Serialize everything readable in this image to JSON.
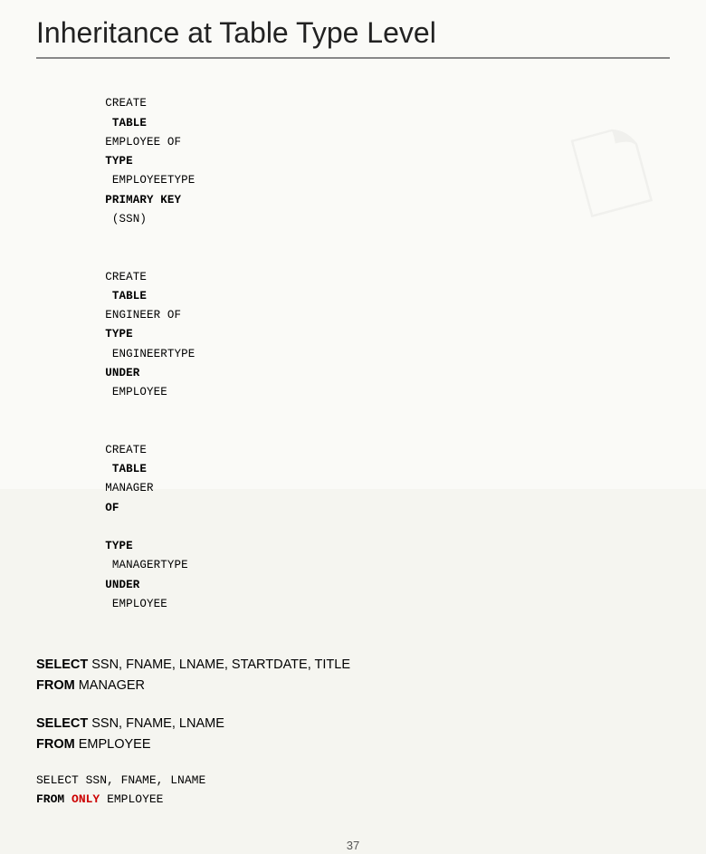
{
  "slide": {
    "title": "Inheritance at Table Type Level",
    "top_border_color": "#c8b84a",
    "bottom_border_color": "#c8b84a",
    "page_number": "37",
    "create_block": {
      "lines": [
        {
          "parts": [
            {
              "text": "CREATE",
              "style": "normal"
            },
            {
              "text": " TABLE ",
              "style": "bold"
            },
            {
              "text": "EMPLOYEE OF ",
              "style": "normal"
            },
            {
              "text": "TYPE",
              "style": "bold"
            },
            {
              "text": " EMPLOYEETYPE ",
              "style": "normal"
            },
            {
              "text": "PRIMARY KEY",
              "style": "bold"
            },
            {
              "text": " (SSN)",
              "style": "normal"
            }
          ]
        },
        {
          "parts": [
            {
              "text": "CREATE",
              "style": "normal"
            },
            {
              "text": " TABLE ",
              "style": "bold"
            },
            {
              "text": "ENGINEER OF ",
              "style": "normal"
            },
            {
              "text": "TYPE",
              "style": "bold"
            },
            {
              "text": " ENGINEERTYPE ",
              "style": "normal"
            },
            {
              "text": "UNDER",
              "style": "bold"
            },
            {
              "text": " EMPLOYEE",
              "style": "normal"
            }
          ]
        },
        {
          "parts": [
            {
              "text": "CREATE",
              "style": "normal"
            },
            {
              "text": " TABLE ",
              "style": "bold"
            },
            {
              "text": "MANAGER ",
              "style": "normal"
            },
            {
              "text": "OF",
              "style": "bold"
            },
            {
              "text": " ",
              "style": "normal"
            },
            {
              "text": "TYPE",
              "style": "bold"
            },
            {
              "text": " MANAGERTYPE ",
              "style": "normal"
            },
            {
              "text": "UNDER",
              "style": "bold"
            },
            {
              "text": " EMPLOYEE",
              "style": "normal"
            }
          ]
        }
      ]
    },
    "select_blocks": [
      {
        "id": "select1",
        "line1_bold": "SELECT",
        "line1_normal": " SSN, FNAME, LNAME, STARTDATE, TITLE",
        "line2_bold": "FROM",
        "line2_normal": " MANAGER"
      },
      {
        "id": "select2",
        "line1_bold": "SELECT",
        "line1_normal": " SSN, FNAME, LNAME",
        "line2_bold": "FROM",
        "line2_normal": " EMPLOYEE"
      },
      {
        "id": "select3",
        "line1_keyword": "SELECT",
        "line1_normal": " SSN,  FNAME,  LNAME",
        "line2_from": "FROM",
        "line2_only": " ONLY",
        "line2_normal": " EMPLOYEE",
        "has_only": true
      }
    ]
  }
}
